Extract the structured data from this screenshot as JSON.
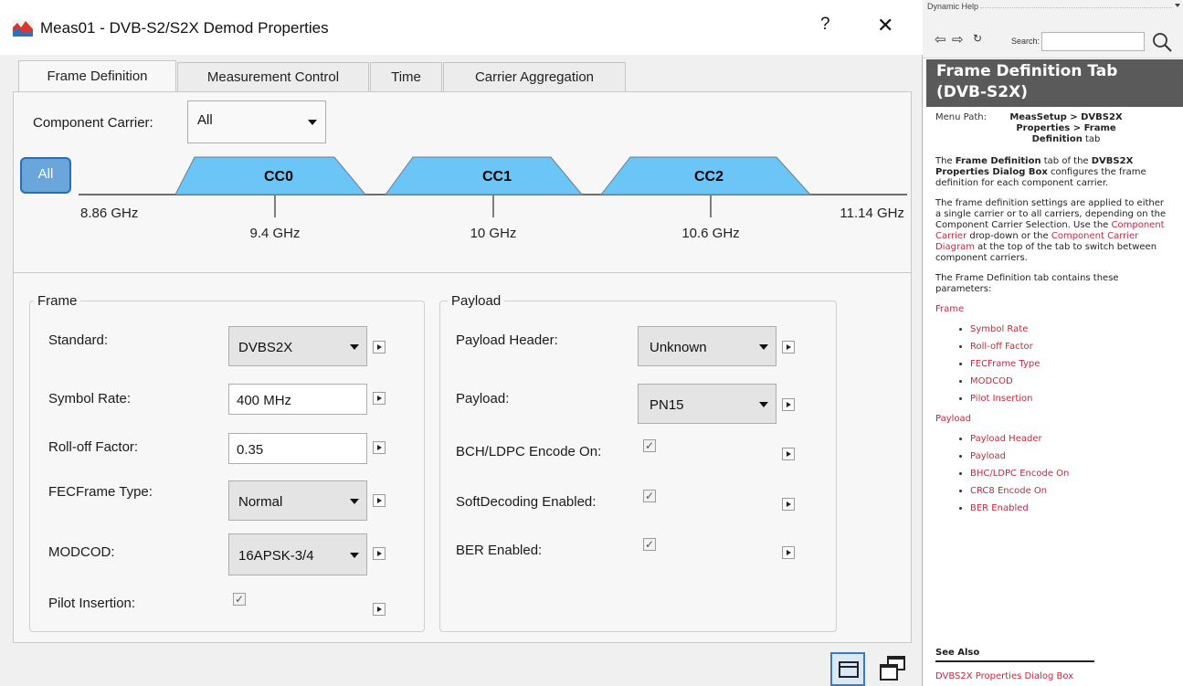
{
  "window": {
    "title": "Meas01 - DVB-S2/S2X Demod Properties",
    "help_label": "?",
    "close_label": "✕"
  },
  "tabs": [
    {
      "label": "Frame Definition",
      "active": true
    },
    {
      "label": "Measurement Control",
      "active": false
    },
    {
      "label": "Time",
      "active": false
    },
    {
      "label": "Carrier Aggregation",
      "active": false
    }
  ],
  "component_carrier": {
    "label": "Component Carrier:",
    "value": "All"
  },
  "diagram": {
    "all_button": "All",
    "start_freq": "8.86 GHz",
    "stop_freq": "11.14 GHz",
    "carriers": [
      {
        "name": "CC0",
        "center": "9.4 GHz"
      },
      {
        "name": "CC1",
        "center": "10 GHz"
      },
      {
        "name": "CC2",
        "center": "10.6 GHz"
      }
    ],
    "fill_color": "#6cc5f7",
    "outline_color": "#6b7f93"
  },
  "frame": {
    "legend": "Frame",
    "standard": {
      "label": "Standard:",
      "value": "DVBS2X"
    },
    "symbol_rate": {
      "label": "Symbol Rate:",
      "value": "400 MHz"
    },
    "rolloff": {
      "label": "Roll-off Factor:",
      "value": "0.35"
    },
    "fecframe": {
      "label": "FECFrame Type:",
      "value": "Normal"
    },
    "modcod": {
      "label": "MODCOD:",
      "value": "16APSK-3/4"
    },
    "pilot": {
      "label": "Pilot Insertion:",
      "checked": true
    }
  },
  "payload": {
    "legend": "Payload",
    "header": {
      "label": "Payload Header:",
      "value": "Unknown"
    },
    "payload": {
      "label": "Payload:",
      "value": "PN15"
    },
    "bch": {
      "label": "BCH/LDPC Encode On:",
      "checked": true
    },
    "soft": {
      "label": "SoftDecoding Enabled:",
      "checked": true
    },
    "ber": {
      "label": "BER Enabled:",
      "checked": true
    }
  },
  "check_glyph": "✓",
  "help": {
    "pane_title": "Dynamic Help",
    "search_label": "Search:",
    "search_value": "",
    "heading_line1": "Frame Definition Tab",
    "heading_line2": "(DVB-S2X)",
    "menu_path_label": "Menu Path:",
    "menu_path_value": "MeasSetup > DVBS2X Properties > Frame Definition",
    "menu_path_suffix": " tab",
    "intro": {
      "pre": "The ",
      "b1": "Frame Definition",
      "mid": " tab of the ",
      "b2": "DVBS2X Properties Dialog Box",
      "post": " configures the frame definition for each component carrier."
    },
    "para2": {
      "pre": "The frame definition settings are applied to either a single carrier or to all carriers, depending on the Component Carrier Selection. Use the ",
      "link1": "Component Carrier",
      "mid": " drop-down or the ",
      "link2": "Component Carrier Diagram",
      "post": " at the top of the tab to switch between component carriers."
    },
    "para3": "The Frame Definition tab contains these parameters:",
    "frame_section": "Frame",
    "frame_items": [
      "Symbol Rate",
      "Roll-off Factor",
      "FECFrame Type",
      "MODCOD",
      "Pilot Insertion"
    ],
    "payload_section": "Payload",
    "payload_items": [
      "Payload Header",
      "Payload",
      "BHC/LDPC Encode On",
      "CRC8 Encode On",
      "BER Enabled"
    ],
    "see_also": "See Also",
    "see_also_link": "DVBS2X Properties Dialog Box"
  }
}
